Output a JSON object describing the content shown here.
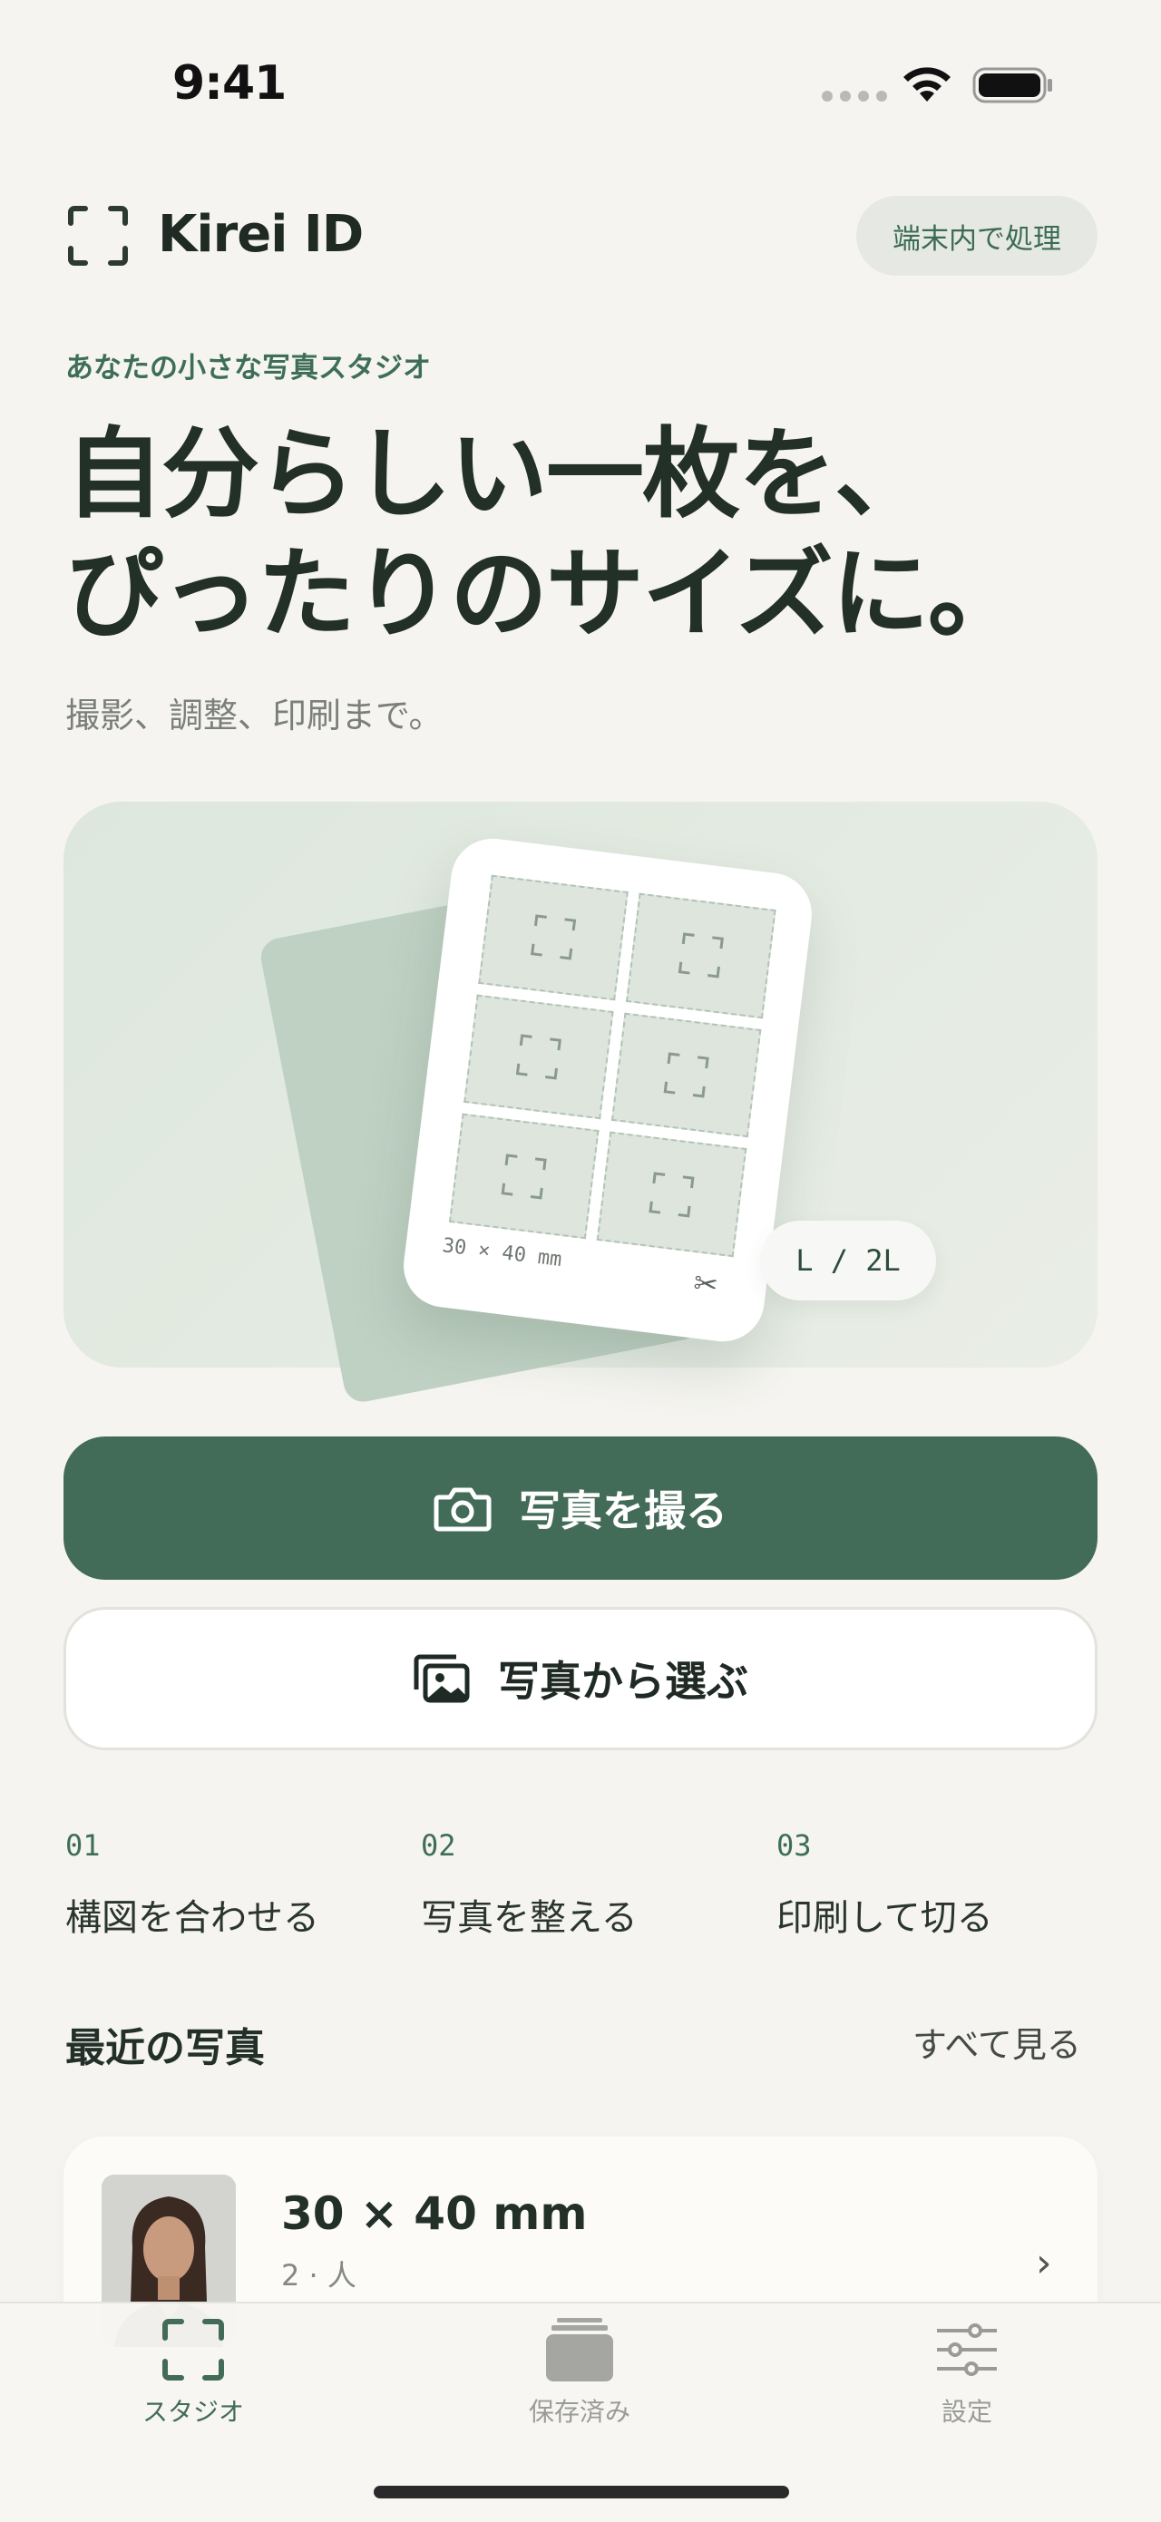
{
  "status_bar": {
    "time": "9:41"
  },
  "header": {
    "app_title": "Kirei ID",
    "device_badge": "端末内で処理"
  },
  "hero_text": {
    "kicker": "あなたの小さな写真スタジオ",
    "headline_line1": "自分らしい一枚を、",
    "headline_line2": "ぴったりのサイズに。",
    "subtitle": "撮影、調整、印刷まで。"
  },
  "hero_illustration": {
    "sheet_size": "30 × 40 mm",
    "print_format": "L / 2L",
    "photo_slots": 6
  },
  "actions": {
    "take_photo": "写真を撮る",
    "choose_photo": "写真から選ぶ"
  },
  "steps": [
    {
      "num": "01",
      "label": "構図を合わせる"
    },
    {
      "num": "02",
      "label": "写真を整える"
    },
    {
      "num": "03",
      "label": "印刷して切る"
    }
  ],
  "recent": {
    "title": "最近の写真",
    "see_all": "すべて見る",
    "items": [
      {
        "size": "30 × 40 mm",
        "meta": "2 · 人"
      }
    ]
  },
  "tabbar": {
    "tabs": [
      {
        "label": "スタジオ",
        "icon": "viewfinder-icon",
        "active": true
      },
      {
        "label": "保存済み",
        "icon": "stack-icon",
        "active": false
      },
      {
        "label": "設定",
        "icon": "sliders-icon",
        "active": false
      }
    ]
  },
  "colors": {
    "accent": "#426b58",
    "background": "#f5f4f0",
    "tab_inactive": "#9a9b96"
  }
}
